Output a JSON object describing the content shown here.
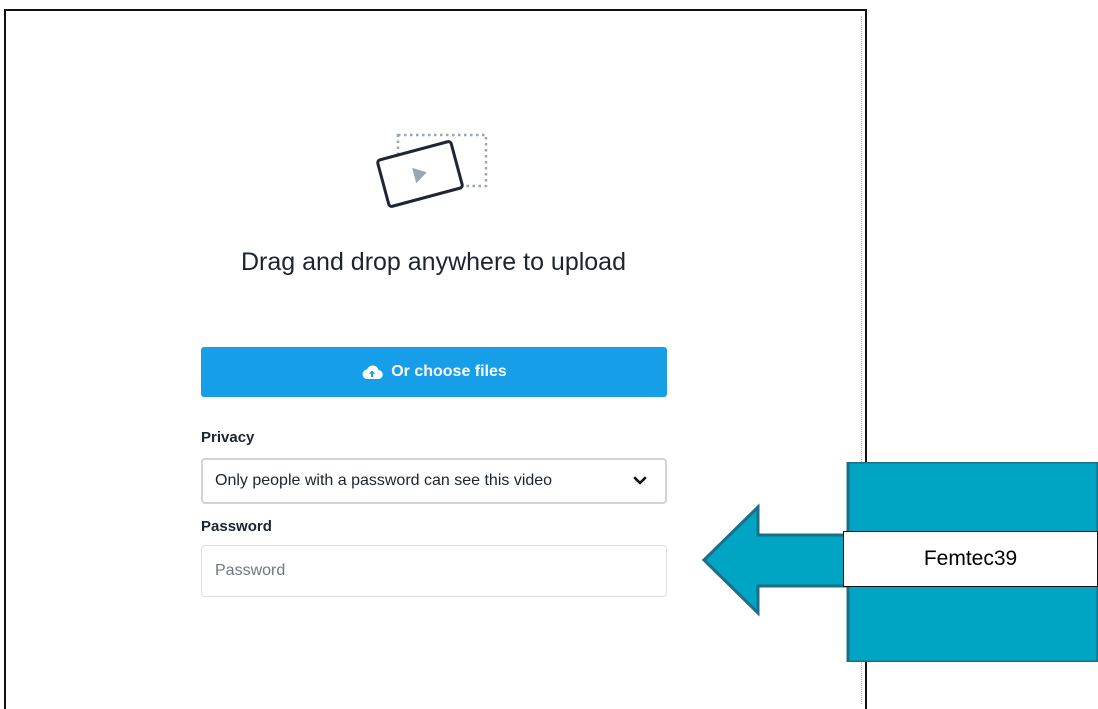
{
  "upload": {
    "heading": "Drag and drop anywhere to upload",
    "choose_files_label": "Or choose files"
  },
  "privacy": {
    "label": "Privacy",
    "selected_option": "Only people with a password can see this video"
  },
  "password": {
    "label": "Password",
    "placeholder": "Password",
    "value": ""
  },
  "annotation": {
    "callout_text": "Femtec39"
  },
  "colors": {
    "accent_button": "#179ee8",
    "arrow_fill": "#00a5c4",
    "arrow_stroke": "#1b6f86"
  },
  "icons": {
    "upload_illustration": "video-upload-icon",
    "button_icon": "cloud-upload-icon",
    "select_chevron": "chevron-down-icon"
  }
}
